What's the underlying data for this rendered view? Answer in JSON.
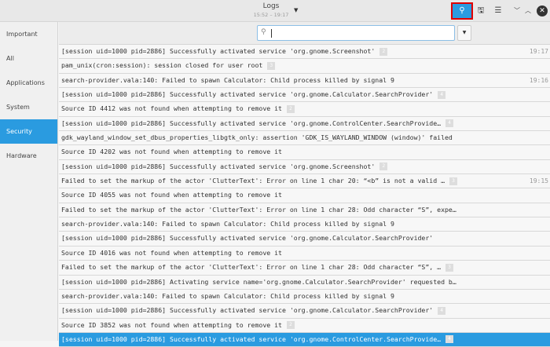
{
  "header": {
    "title": "Logs",
    "time_range": "15:52 – 19:17"
  },
  "sidebar": {
    "items": [
      {
        "label": "Important"
      },
      {
        "label": "All"
      },
      {
        "label": "Applications"
      },
      {
        "label": "System"
      },
      {
        "label": "Security"
      },
      {
        "label": "Hardware"
      }
    ],
    "selected": "Security"
  },
  "search": {
    "value": "",
    "placeholder": ""
  },
  "rows": [
    {
      "text": "[session uid=1000 pid=2886] Successfully activated service 'org.gnome.Screenshot'",
      "count": "2",
      "time": "19:17"
    },
    {
      "text": "pam_unix(cron:session): session closed for user root",
      "count": "3",
      "time": ""
    },
    {
      "text": "search-provider.vala:140: Failed to spawn Calculator: Child process killed by signal 9",
      "count": "",
      "time": "19:16"
    },
    {
      "text": "[session uid=1000 pid=2886] Successfully activated service 'org.gnome.Calculator.SearchProvider'",
      "count": "4",
      "time": ""
    },
    {
      "text": "Source ID 4412 was not found when attempting to remove it",
      "count": "2",
      "time": ""
    },
    {
      "text": "[session uid=1000 pid=2886] Successfully activated service 'org.gnome.ControlCenter.SearchProvide…",
      "count": "4",
      "time": ""
    },
    {
      "text": "gdk_wayland_window_set_dbus_properties_libgtk_only: assertion 'GDK_IS_WAYLAND_WINDOW (window)' failed",
      "count": "",
      "time": ""
    },
    {
      "text": "Source ID 4202 was not found when attempting to remove it",
      "count": "",
      "time": ""
    },
    {
      "text": "[session uid=1000 pid=2886] Successfully activated service 'org.gnome.Screenshot'",
      "count": "2",
      "time": ""
    },
    {
      "text": "Failed to set the markup of the actor 'ClutterText': Error on line 1 char 20: “<b” is not a valid …",
      "count": "3",
      "time": "19:15"
    },
    {
      "text": "Source ID 4055 was not found when attempting to remove it",
      "count": "",
      "time": ""
    },
    {
      "text": "Failed to set the markup of the actor 'ClutterText': Error on line 1 char 28: Odd character “S”, expe…",
      "count": "",
      "time": ""
    },
    {
      "text": "search-provider.vala:140: Failed to spawn Calculator: Child process killed by signal 9",
      "count": "",
      "time": ""
    },
    {
      "text": "[session uid=1000 pid=2886] Successfully activated service 'org.gnome.Calculator.SearchProvider'",
      "count": "",
      "time": ""
    },
    {
      "text": "Source ID 4016 was not found when attempting to remove it",
      "count": "",
      "time": ""
    },
    {
      "text": "Failed to set the markup of the actor 'ClutterText': Error on line 1 char 28: Odd character “S”, …",
      "count": "3",
      "time": ""
    },
    {
      "text": "[session uid=1000 pid=2886] Activating service name='org.gnome.Calculator.SearchProvider' requested b…",
      "count": "",
      "time": ""
    },
    {
      "text": "search-provider.vala:140: Failed to spawn Calculator: Child process killed by signal 9",
      "count": "",
      "time": ""
    },
    {
      "text": "[session uid=1000 pid=2886] Successfully activated service 'org.gnome.Calculator.SearchProvider'",
      "count": "4",
      "time": ""
    },
    {
      "text": "Source ID 3852 was not found when attempting to remove it",
      "count": "2",
      "time": ""
    },
    {
      "text": "[session uid=1000 pid=2886] Successfully activated service 'org.gnome.ControlCenter.SearchProvide…",
      "count": "4",
      "time": ""
    }
  ],
  "selected_row": 20,
  "colors": {
    "accent": "#2a9be0",
    "highlight": "#e00000"
  }
}
